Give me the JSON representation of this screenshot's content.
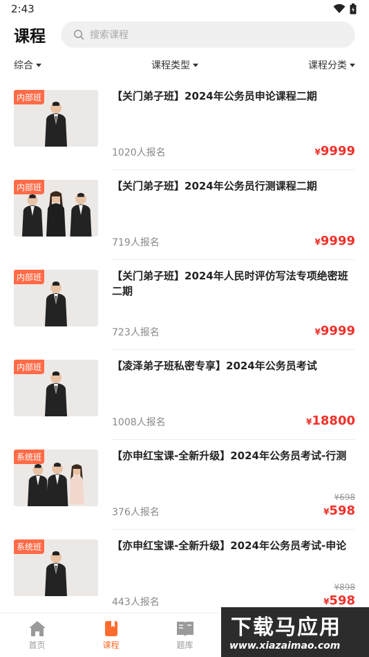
{
  "status_bar": {
    "time": "2:43"
  },
  "header": {
    "title": "课程",
    "search_placeholder": "搜索课程"
  },
  "filters": [
    {
      "label": "综合"
    },
    {
      "label": "课程类型"
    },
    {
      "label": "课程分类"
    }
  ],
  "courses": [
    {
      "badge": "内部班",
      "title": "【关门弟子班】2024年公务员申论课程二期",
      "enrolled": "1020人报名",
      "currency": "¥",
      "price": "9999",
      "original_price": ""
    },
    {
      "badge": "内部班",
      "title": "【关门弟子班】2024年公务员行测课程二期",
      "enrolled": "719人报名",
      "currency": "¥",
      "price": "9999",
      "original_price": ""
    },
    {
      "badge": "内部班",
      "title": "【关门弟子班】2024年人民时评仿写法专项绝密班二期",
      "enrolled": "723人报名",
      "currency": "¥",
      "price": "9999",
      "original_price": ""
    },
    {
      "badge": "内部班",
      "title": "【凌泽弟子班私密专享】2024年公务员考试",
      "enrolled": "1008人报名",
      "currency": "¥",
      "price": "18800",
      "original_price": ""
    },
    {
      "badge": "系统班",
      "title": "【亦申红宝课-全新升级】2024年公务员考试-行测",
      "enrolled": "376人报名",
      "currency": "¥",
      "price": "598",
      "original_price": "¥698"
    },
    {
      "badge": "系统班",
      "title": "【亦申红宝课-全新升级】2024年公务员考试-申论",
      "enrolled": "443人报名",
      "currency": "¥",
      "price": "598",
      "original_price": "¥898"
    }
  ],
  "tabs": [
    {
      "label": "首页",
      "icon": "home-icon"
    },
    {
      "label": "课程",
      "icon": "course-book-icon",
      "active": true
    },
    {
      "label": "题库",
      "icon": "question-bank-icon"
    }
  ],
  "watermark": {
    "text": "下载马应用",
    "url": "www.xiazaimao.com"
  },
  "colors": {
    "accent": "#ff6b2c",
    "price": "#f0302a",
    "badge": "#ff6b47"
  }
}
